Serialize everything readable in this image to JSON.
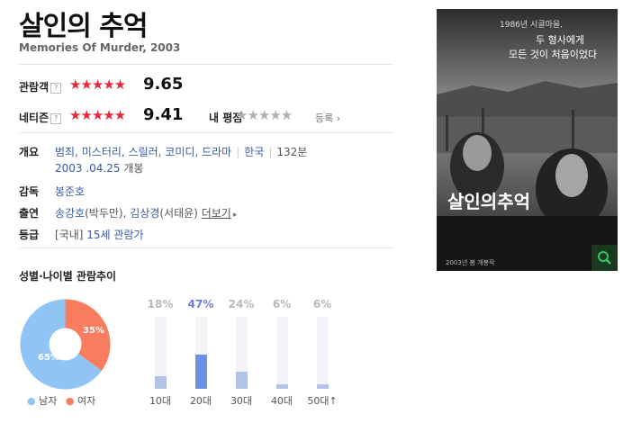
{
  "title": "살인의 추억",
  "subtitle": "Memories Of Murder, 2003",
  "ratings": {
    "audience": {
      "label": "관람객",
      "help": "?",
      "stars": "★★★★★",
      "score": "9.65",
      "value": 9.65
    },
    "netizen": {
      "label": "네티즌",
      "help": "?",
      "stars": "★★★★★",
      "score": "9.41",
      "value": 9.41
    },
    "mine": {
      "label": "내 평점",
      "stars": "★★★★★",
      "register": "등록",
      "arrow": "›"
    }
  },
  "info": {
    "overview_label": "개요",
    "genres": [
      "범죄",
      "미스터리",
      "스릴러",
      "코미디",
      "드라마"
    ],
    "country": "한국",
    "runtime": "132분",
    "release_date": "2003 .04.25",
    "release_suffix": " 개봉",
    "director_label": "감독",
    "director": "봉준호",
    "cast_label": "출연",
    "cast1": "송강호",
    "cast1_role": "(박두만)",
    "cast2": "김상경",
    "cast2_role": "(서태윤)",
    "more": "더보기",
    "more_arrow": "▸",
    "grade_label": "등급",
    "grade_prefix": "[국내]",
    "grade": "15세 관람가"
  },
  "poster": {
    "top_text": "1986년 시골마을,",
    "headline1": "두 형사에게",
    "headline2": "모든 것이 처음이었다",
    "logo_text": "살인의추억",
    "bottom_text": "2003년 봄 개봉작",
    "zoom_icon": "magnifier-icon"
  },
  "stats": {
    "title": "성별·나이별 관람추이",
    "legend_male": "남자",
    "legend_female": "여자",
    "male_label": "65%",
    "female_label": "35%",
    "colors": {
      "male": "#8fc4f5",
      "female": "#f77d5e",
      "bar": "#b3c2e6",
      "bar_highlight": "#6e8fe6",
      "pct_highlight": "#6b7fd6"
    }
  },
  "chart_data": [
    {
      "type": "pie",
      "categories": [
        "남자",
        "여자"
      ],
      "values": [
        65,
        35
      ],
      "labels": [
        "65%",
        "35%"
      ],
      "title": "성별·나이별 관람추이"
    },
    {
      "type": "bar",
      "categories": [
        "10대",
        "20대",
        "30대",
        "40대",
        "50대↑"
      ],
      "values": [
        18,
        47,
        24,
        6,
        6
      ],
      "labels": [
        "18%",
        "47%",
        "24%",
        "6%",
        "6%"
      ],
      "highlight": "20대",
      "ylim": [
        0,
        100
      ]
    }
  ]
}
